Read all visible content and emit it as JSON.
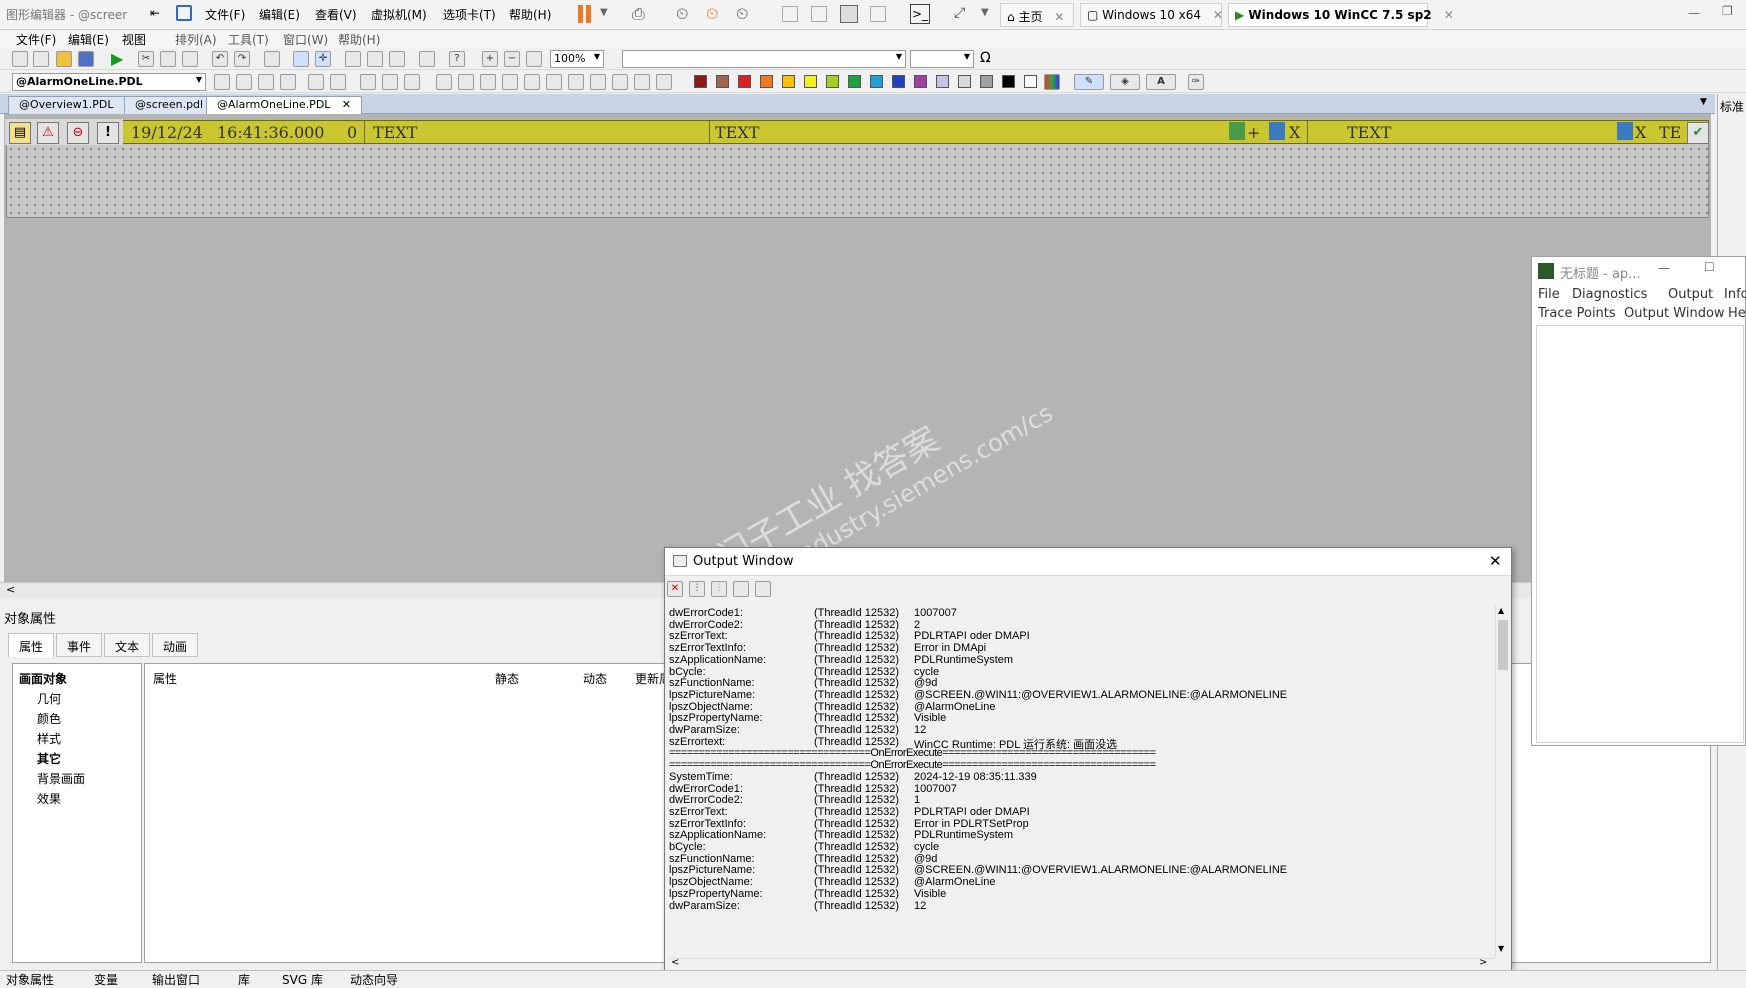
{
  "vm": {
    "app_title": "图形编辑器 - @screer",
    "menu": [
      "文件(F)",
      "编辑(E)",
      "查看(V)",
      "虚拟机(M)",
      "选项卡(T)",
      "帮助(H)"
    ],
    "tabs": [
      {
        "label": "主页"
      },
      {
        "label": "Windows 10 x64"
      },
      {
        "label": "Windows 10 WinCC 7.5 sp2"
      }
    ]
  },
  "app_menu": [
    "文件(F)",
    "编辑(E)",
    "视图",
    "排列(A)",
    "工具(T)",
    "窗口(W)",
    "帮助(H)"
  ],
  "toolbar": {
    "zoom": "100%",
    "object_combo": "@AlarmOneLine.PDL",
    "font_symbol": "Ω",
    "swatches": [
      "#8b1a1a",
      "#a0664a",
      "#e02020",
      "#f07820",
      "#f8c010",
      "#f0f020",
      "#a0d020",
      "#20a040",
      "#20a0d0",
      "#2040c0",
      "#a040a0",
      "#c8c0e8",
      "#d8d8d8",
      "#a0a0a0",
      "#000000",
      "#ffffff"
    ]
  },
  "doc_tabs": [
    "@Overview1.PDL",
    "@screen.pdl",
    "@AlarmOneLine.PDL"
  ],
  "alarm_bar": {
    "date": "19/12/24",
    "time": "16:41:36.000",
    "number": "0",
    "text1": "TEXT",
    "text2": "TEXT",
    "text3": "TEXT",
    "x1": "X",
    "x2": "X",
    "te": "TE",
    "plus": "+"
  },
  "watermark": {
    "line1": "西门子工业 找答案",
    "line2": "support.industry.siemens.com/cs"
  },
  "object_properties": {
    "title": "对象属性",
    "tabs": [
      "属性",
      "事件",
      "文本",
      "动画"
    ],
    "tree_root": "画面对象",
    "tree_items": [
      "几何",
      "颜色",
      "样式",
      "其它",
      "背景画面",
      "效果"
    ],
    "columns": [
      "属性",
      "静态",
      "动态",
      "更新周"
    ]
  },
  "status_bar": [
    "对象属性",
    "变量",
    "输出窗口",
    "库",
    "SVG 库",
    "动态向导"
  ],
  "right_panel": {
    "label": "标准"
  },
  "ap_window": {
    "title": "无标题 - ap...",
    "menu1": [
      "File",
      "Diagnostics",
      "Output",
      "Info"
    ],
    "menu2": [
      "Trace Points",
      "Output Window",
      "He"
    ]
  },
  "output_window": {
    "title": "Output Window",
    "log": [
      {
        "k": "dwErrorCode1:",
        "t": "(ThreadId 12532)",
        "v": "1007007"
      },
      {
        "k": "dwErrorCode2:",
        "t": "(ThreadId 12532)",
        "v": "2"
      },
      {
        "k": "szErrorText:",
        "t": "(ThreadId 12532)",
        "v": "PDLRTAPI oder DMAPI"
      },
      {
        "k": "szErrorTextInfo:",
        "t": "(ThreadId 12532)",
        "v": "Error in DMApi"
      },
      {
        "k": "szApplicationName:",
        "t": "(ThreadId 12532)",
        "v": "PDLRuntimeSystem"
      },
      {
        "k": "bCycle:",
        "t": "(ThreadId 12532)",
        "v": "cycle"
      },
      {
        "k": "szFunctionName:",
        "t": "(ThreadId 12532)",
        "v": "@9d"
      },
      {
        "k": "lpszPictureName:",
        "t": "(ThreadId 12532)",
        "v": "@SCREEN.@WIN11:@OVERVIEW1.ALARMONELINE:@ALARMONELINE"
      },
      {
        "k": "lpszObjectName:",
        "t": "(ThreadId 12532)",
        "v": "@AlarmOneLine"
      },
      {
        "k": "lpszPropertyName:",
        "t": "(ThreadId 12532)",
        "v": "Visible"
      },
      {
        "k": "dwParamSize:",
        "t": "(ThreadId 12532)",
        "v": "12"
      },
      {
        "k": "szErrortext:",
        "t": "(ThreadId 12532)",
        "v": "WinCC Runtime: PDL 运行系统: 画面没选"
      },
      {
        "sep": "==================================OnErrorExecute===================================="
      },
      {
        "sep": "==================================OnErrorExecute===================================="
      },
      {
        "k": "SystemTime:",
        "t": "(ThreadId 12532)",
        "v": "2024-12-19 08:35:11.339"
      },
      {
        "k": "dwErrorCode1:",
        "t": "(ThreadId 12532)",
        "v": "1007007"
      },
      {
        "k": "dwErrorCode2:",
        "t": "(ThreadId 12532)",
        "v": "1"
      },
      {
        "k": "szErrorText:",
        "t": "(ThreadId 12532)",
        "v": "PDLRTAPI oder DMAPI"
      },
      {
        "k": "szErrorTextInfo:",
        "t": "(ThreadId 12532)",
        "v": "Error in PDLRTSetProp"
      },
      {
        "k": "szApplicationName:",
        "t": "(ThreadId 12532)",
        "v": "PDLRuntimeSystem"
      },
      {
        "k": "bCycle:",
        "t": "(ThreadId 12532)",
        "v": "cycle"
      },
      {
        "k": "szFunctionName:",
        "t": "(ThreadId 12532)",
        "v": "@9d"
      },
      {
        "k": "lpszPictureName:",
        "t": "(ThreadId 12532)",
        "v": "@SCREEN.@WIN11:@OVERVIEW1.ALARMONELINE:@ALARMONELINE"
      },
      {
        "k": "lpszObjectName:",
        "t": "(ThreadId 12532)",
        "v": "@AlarmOneLine"
      },
      {
        "k": "lpszPropertyName:",
        "t": "(ThreadId 12532)",
        "v": "Visible"
      },
      {
        "k": "dwParamSize:",
        "t": "(ThreadId 12532)",
        "v": "12"
      }
    ]
  }
}
